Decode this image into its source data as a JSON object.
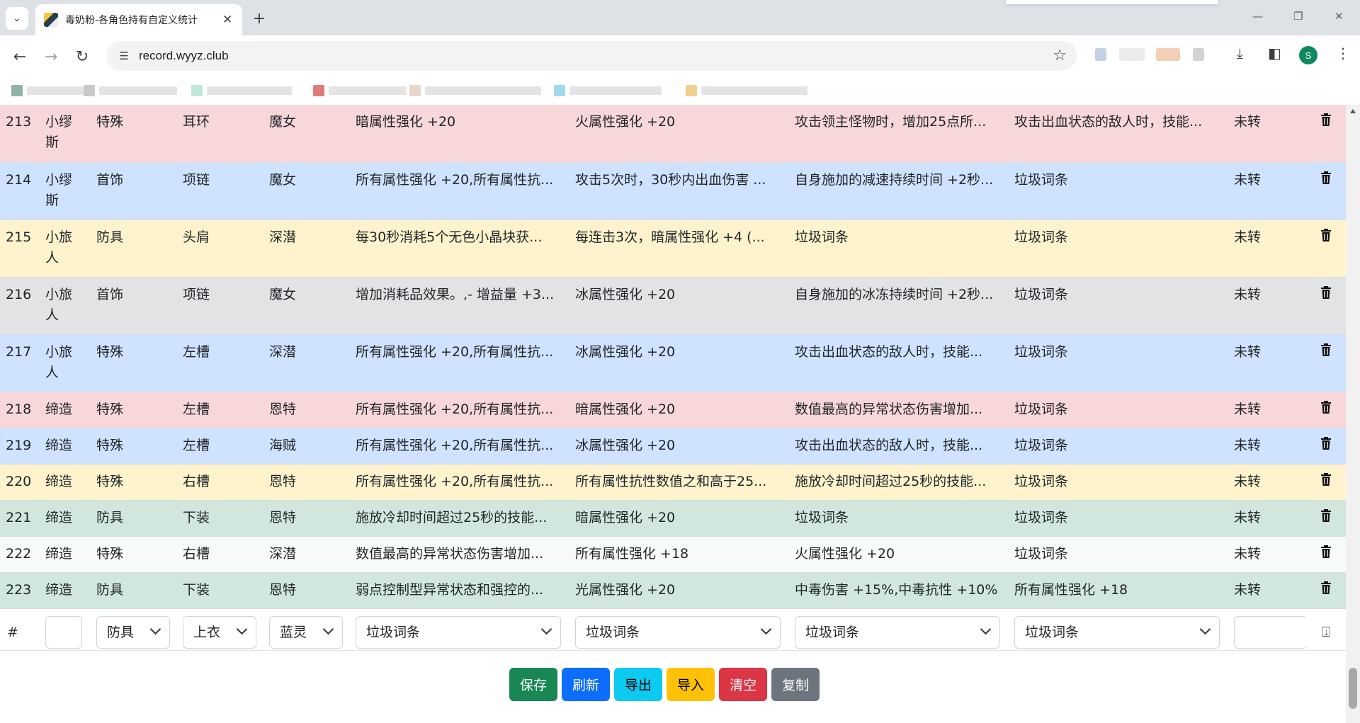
{
  "browser": {
    "tab_title": "毒奶粉-各角色持有自定义统计",
    "tab_close": "✕",
    "new_tab": "+",
    "url": "record.wyyz.club",
    "profile_initial": "S"
  },
  "rows": [
    {
      "id": "213",
      "char": "小缪斯",
      "type": "特殊",
      "slot": "耳环",
      "set": "魔女",
      "a1": "暗属性强化 +20",
      "a2": "火属性强化 +20",
      "a3": "攻击领主怪物时，增加25点所...",
      "a4": "攻击出血状态的敌人时，技能...",
      "status": "未转",
      "style": "danger",
      "tall": true
    },
    {
      "id": "214",
      "char": "小缪斯",
      "type": "首饰",
      "slot": "项链",
      "set": "魔女",
      "a1": "所有属性强化 +20,所有属性抗...",
      "a2": "攻击5次时，30秒内出血伤害 ...",
      "a3": "自身施加的减速持续时间 +2秒...",
      "a4": "垃圾词条",
      "status": "未转",
      "style": "primary",
      "tall": true
    },
    {
      "id": "215",
      "char": "小旅人",
      "type": "防具",
      "slot": "头肩",
      "set": "深潜",
      "a1": "每30秒消耗5个无色小晶块获...",
      "a2": "每连击3次，暗属性强化 +4 (...",
      "a3": "垃圾词条",
      "a4": "垃圾词条",
      "status": "未转",
      "style": "warning",
      "tall": true
    },
    {
      "id": "216",
      "char": "小旅人",
      "type": "首饰",
      "slot": "项链",
      "set": "魔女",
      "a1": "增加消耗品效果。,- 增益量 +3...",
      "a2": "冰属性强化 +20",
      "a3": "自身施加的冰冻持续时间 +2秒...",
      "a4": "垃圾词条",
      "status": "未转",
      "style": "secondary",
      "tall": true
    },
    {
      "id": "217",
      "char": "小旅人",
      "type": "特殊",
      "slot": "左槽",
      "set": "深潜",
      "a1": "所有属性强化 +20,所有属性抗...",
      "a2": "冰属性强化 +20",
      "a3": "攻击出血状态的敌人时，技能...",
      "a4": "垃圾词条",
      "status": "未转",
      "style": "primary",
      "tall": true
    },
    {
      "id": "218",
      "char": "缔造",
      "type": "特殊",
      "slot": "左槽",
      "set": "恩特",
      "a1": "所有属性强化 +20,所有属性抗...",
      "a2": "暗属性强化 +20",
      "a3": "数值最高的异常状态伤害增加...",
      "a4": "垃圾词条",
      "status": "未转",
      "style": "danger",
      "tall": false
    },
    {
      "id": "219",
      "char": "缔造",
      "type": "特殊",
      "slot": "左槽",
      "set": "海贼",
      "a1": "所有属性强化 +20,所有属性抗...",
      "a2": "冰属性强化 +20",
      "a3": "攻击出血状态的敌人时，技能...",
      "a4": "垃圾词条",
      "status": "未转",
      "style": "primary",
      "tall": false
    },
    {
      "id": "220",
      "char": "缔造",
      "type": "特殊",
      "slot": "右槽",
      "set": "恩特",
      "a1": "所有属性强化 +20,所有属性抗...",
      "a2": "所有属性抗性数值之和高于25...",
      "a3": "施放冷却时间超过25秒的技能...",
      "a4": "垃圾词条",
      "status": "未转",
      "style": "warning",
      "tall": false
    },
    {
      "id": "221",
      "char": "缔造",
      "type": "防具",
      "slot": "下装",
      "set": "恩特",
      "a1": "施放冷却时间超过25秒的技能...",
      "a2": "暗属性强化 +20",
      "a3": "垃圾词条",
      "a4": "垃圾词条",
      "status": "未转",
      "style": "success",
      "tall": false
    },
    {
      "id": "222",
      "char": "缔造",
      "type": "特殊",
      "slot": "右槽",
      "set": "深潜",
      "a1": "数值最高的异常状态伤害增加...",
      "a2": "所有属性强化 +18",
      "a3": "火属性强化 +20",
      "a4": "垃圾词条",
      "status": "未转",
      "style": "light",
      "tall": false
    },
    {
      "id": "223",
      "char": "缔造",
      "type": "防具",
      "slot": "下装",
      "set": "恩特",
      "a1": "弱点控制型异常状态和强控的...",
      "a2": "光属性强化 +20",
      "a3": "中毒伤害 +15%,中毒抗性 +10%",
      "a4": "所有属性强化 +18",
      "status": "未转",
      "style": "success",
      "tall": false
    }
  ],
  "input_row": {
    "num_label": "#",
    "type": "防具",
    "slot": "上衣",
    "set": "蓝灵",
    "a1": "垃圾词条",
    "a2": "垃圾词条",
    "a3": "垃圾词条",
    "a4": "垃圾词条"
  },
  "buttons": {
    "save": "保存",
    "refresh": "刷新",
    "export": "导出",
    "import": "导入",
    "clear": "清空",
    "copy": "复制"
  },
  "colors": {
    "danger": "#f8d7da",
    "primary": "#cfe2ff",
    "warning": "#fff3cd",
    "secondary": "#e2e3e5",
    "success": "#d1e7dd",
    "light": "#f8f9fa"
  }
}
